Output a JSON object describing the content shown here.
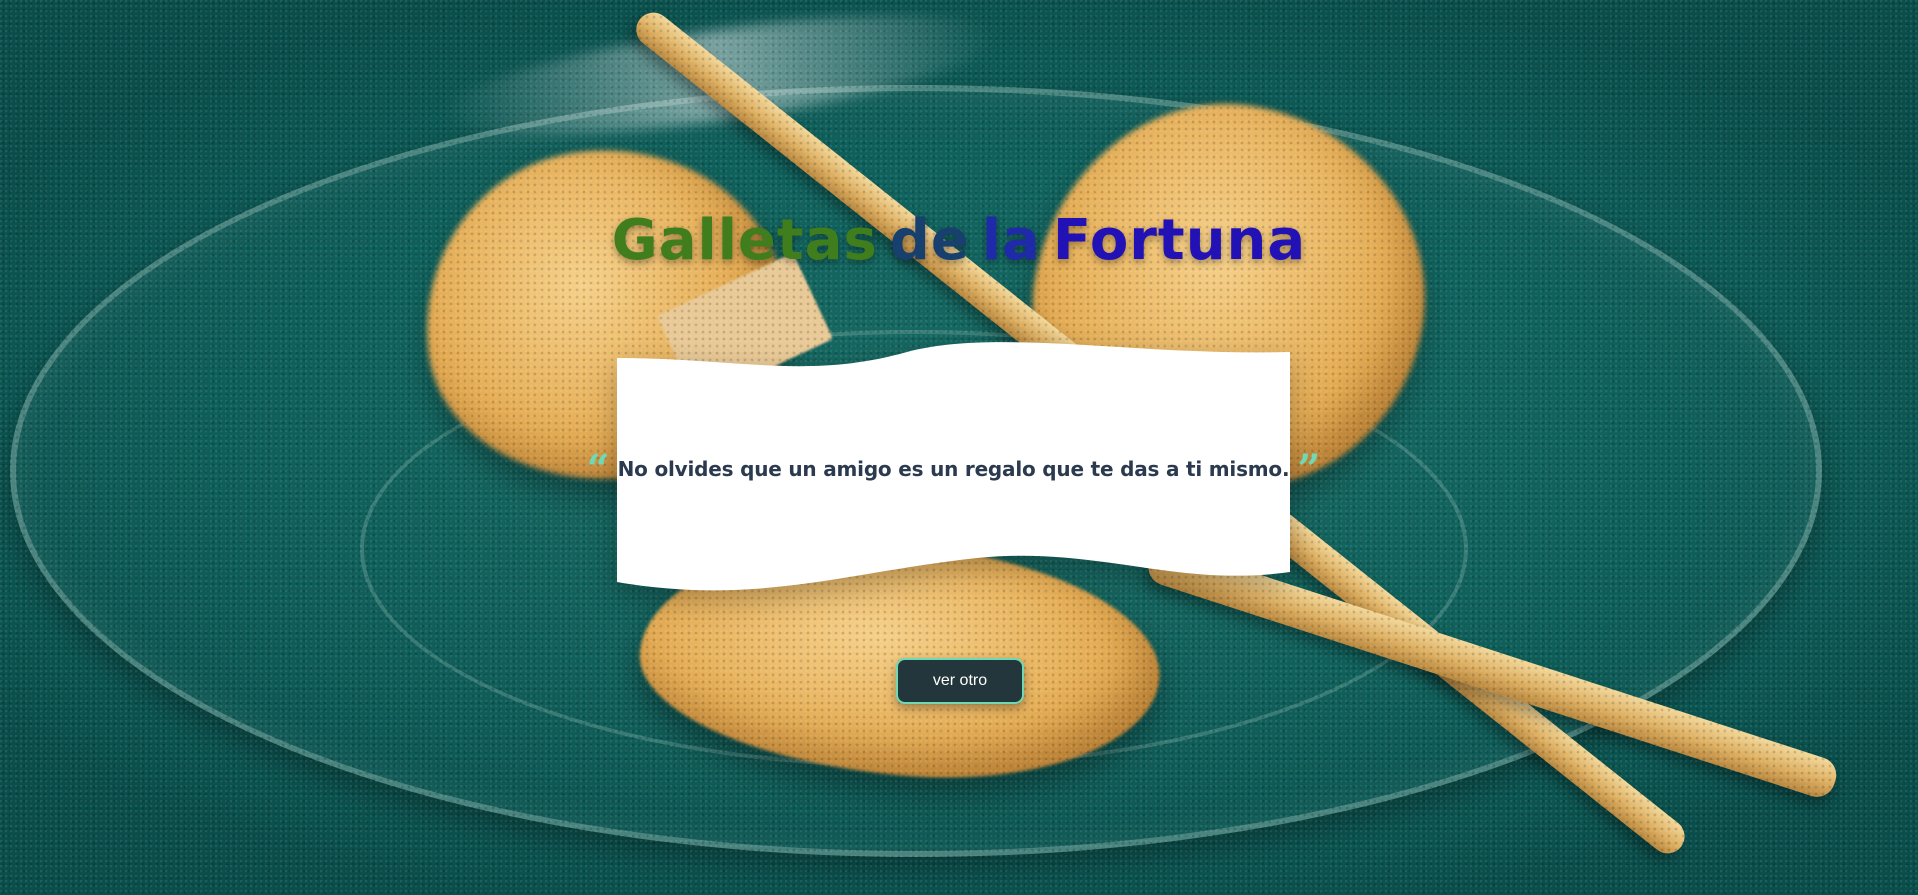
{
  "page": {
    "title_words": [
      "Galletas",
      "de",
      "la",
      "Fortuna"
    ],
    "title_colors": [
      "#3f7d1d",
      "#17406e",
      "#1e2aa8",
      "#2211b4"
    ]
  },
  "fortune": {
    "open_quote": "“",
    "text": "No olvides que un amigo es un regalo que te das a ti mismo.",
    "close_quote": "”",
    "quote_icon_color": "#6fd8b4",
    "text_color": "#2b3a4e"
  },
  "actions": {
    "next_label": "ver otro",
    "button_border_color": "#6fd8b4"
  },
  "background": {
    "description_icon": "fortune-cookies-photo"
  }
}
